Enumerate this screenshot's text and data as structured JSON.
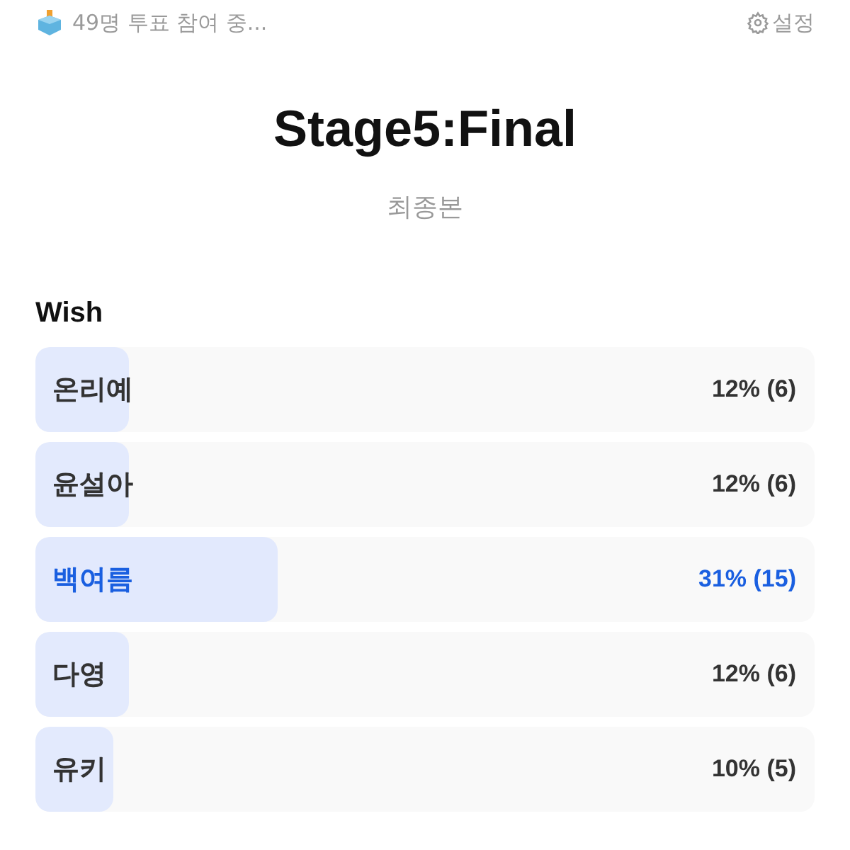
{
  "header": {
    "status": "49명 투표 참여 중...",
    "settings": "설정"
  },
  "title": "Stage5:Final",
  "subtitle": "최종본",
  "section": "Wish",
  "options": [
    {
      "name": "온리예",
      "result": "12% (6)",
      "level": 0.12,
      "selected": false
    },
    {
      "name": "윤설아",
      "result": "12% (6)",
      "level": 0.12,
      "selected": false
    },
    {
      "name": "백여름",
      "result": "31% (15)",
      "level": 0.31,
      "selected": true
    },
    {
      "name": "다영",
      "result": "12% (6)",
      "level": 0.12,
      "selected": false
    },
    {
      "name": "유키",
      "result": "10% (5)",
      "level": 0.1,
      "selected": false
    }
  ]
}
